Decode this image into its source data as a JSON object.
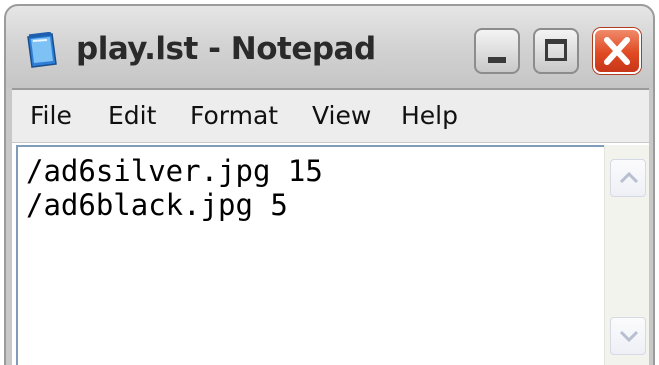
{
  "window": {
    "title": "play.lst - Notepad"
  },
  "menu": [
    {
      "label": "File"
    },
    {
      "label": "Edit"
    },
    {
      "label": "Format"
    },
    {
      "label": "View"
    },
    {
      "label": "Help"
    }
  ],
  "editor": {
    "lines": [
      "/ad6silver.jpg 15",
      "/ad6black.jpg 5"
    ]
  },
  "icons": {
    "app": "notepad-icon",
    "minimize": "minimize-icon",
    "maximize": "maximize-icon",
    "close": "close-icon",
    "scroll_up": "chevron-up-icon",
    "scroll_down": "chevron-down-icon"
  },
  "colors": {
    "close_button": "#e04a22",
    "titlebar": "#d4d4d4",
    "menubar": "#ededed",
    "editor_border": "#7f9db9"
  }
}
